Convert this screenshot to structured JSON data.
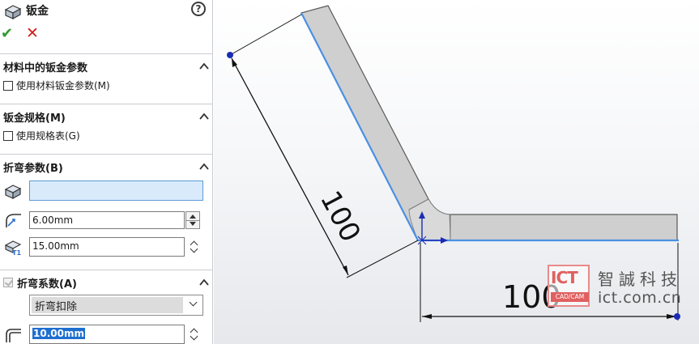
{
  "panel": {
    "title": "钣金",
    "help": "?",
    "ok": "✔",
    "cancel": "✕",
    "material": {
      "title": "材料中的钣金参数",
      "checkbox": "使用材料钣金参数(M)"
    },
    "gauge": {
      "title": "钣金规格(M)",
      "checkbox": "使用规格表(G)"
    },
    "bend_params": {
      "title": "折弯参数(B)",
      "face_value": "",
      "radius": "6.00mm",
      "thickness": "15.00mm"
    },
    "bend_allowance": {
      "title": "折弯系数(A)",
      "type": "折弯扣除",
      "value": "10.00mm"
    }
  },
  "viewport": {
    "dim_angled": "100",
    "dim_horizontal": "100",
    "colors": {
      "edge": "#4a90e2",
      "part_fill": "#cfcfcf",
      "part_outline": "#5a5a5a"
    }
  },
  "watermark": {
    "logo": "ICT",
    "logo_sub": "CAD/CAM",
    "cn": "智誠科技",
    "url": "ict.com.cn"
  }
}
